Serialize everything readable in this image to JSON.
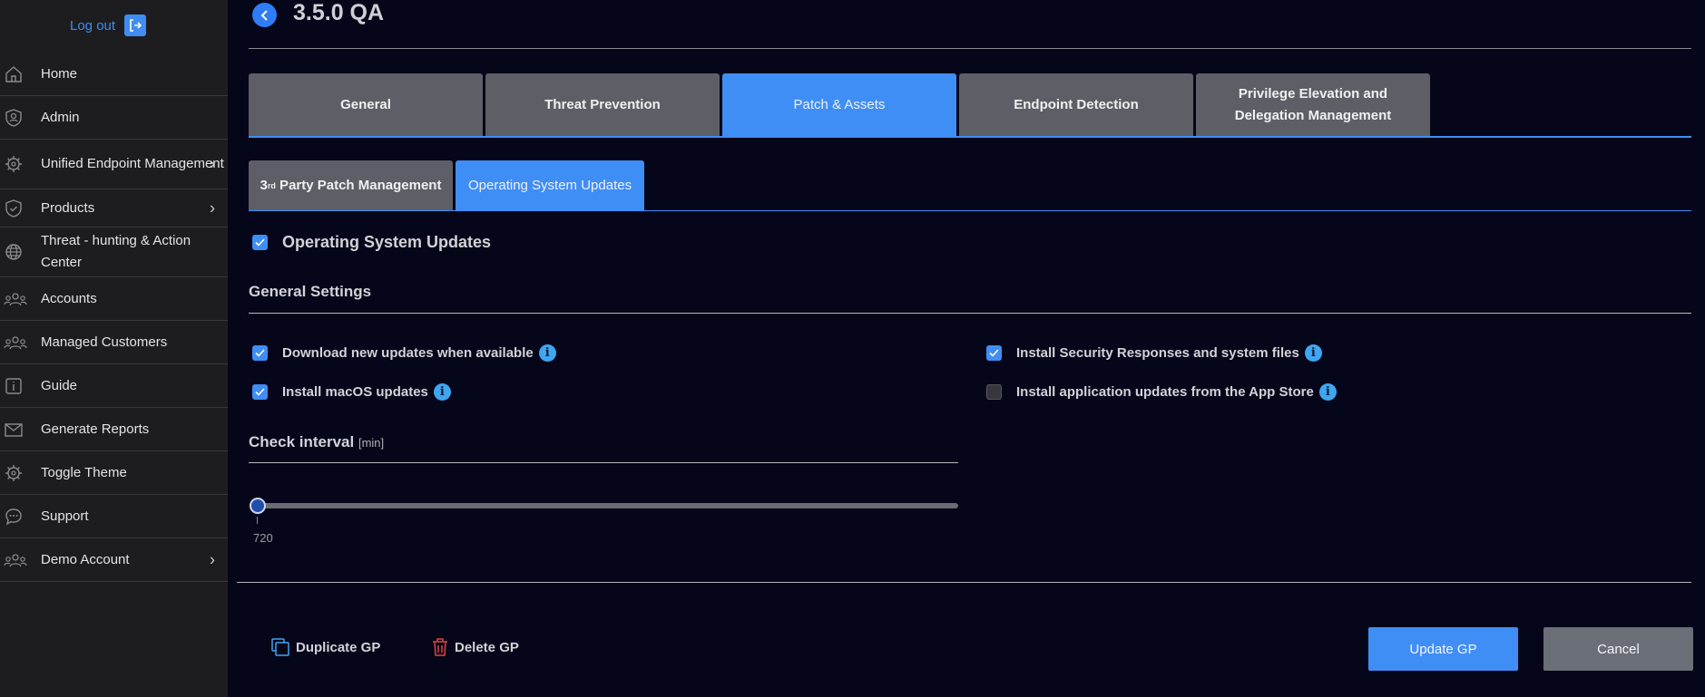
{
  "sidebar": {
    "logout_label": "Log out",
    "items": [
      {
        "label": "Home",
        "icon": "home-icon",
        "chevron": false
      },
      {
        "label": "Admin",
        "icon": "admin-shield-icon",
        "chevron": false
      },
      {
        "label": "Unified Endpoint Management",
        "icon": "gear-icon",
        "chevron": true
      },
      {
        "label": "Products",
        "icon": "shield-check-icon",
        "chevron": true
      },
      {
        "label": "Threat - hunting & Action Center",
        "icon": "globe-icon",
        "chevron": false
      },
      {
        "label": "Accounts",
        "icon": "users-icon",
        "chevron": false
      },
      {
        "label": "Managed Customers",
        "icon": "users-icon",
        "chevron": false
      },
      {
        "label": "Guide",
        "icon": "info-box-icon",
        "chevron": false
      },
      {
        "label": "Generate Reports",
        "icon": "mail-icon",
        "chevron": false
      },
      {
        "label": "Toggle Theme",
        "icon": "gear-icon",
        "chevron": false
      },
      {
        "label": "Support",
        "icon": "chat-icon",
        "chevron": false
      },
      {
        "label": "Demo Account",
        "icon": "users-icon",
        "chevron": true
      }
    ]
  },
  "header": {
    "title": "3.5.0 QA"
  },
  "tabs": [
    {
      "label": "General",
      "active": false
    },
    {
      "label": "Threat Prevention",
      "active": false
    },
    {
      "label": "Patch & Assets",
      "active": true
    },
    {
      "label": "Endpoint Detection",
      "active": false
    },
    {
      "label": "Privilege Elevation and Delegation Management",
      "active": false
    }
  ],
  "subtabs": {
    "third_party": {
      "prefix": "3",
      "sup": "rd",
      "suffix": " Party Patch Management"
    },
    "os_updates": "Operating System Updates"
  },
  "os_updates": {
    "label": "Operating System Updates",
    "checked": true
  },
  "general_settings": {
    "title": "General Settings",
    "options": {
      "download": {
        "label": "Download new updates when available",
        "checked": true
      },
      "macos": {
        "label": "Install macOS updates",
        "checked": true
      },
      "security": {
        "label": "Install Security Responses and system files",
        "checked": true
      },
      "appstore": {
        "label": "Install application updates from the App Store",
        "checked": false
      }
    }
  },
  "check_interval": {
    "title": "Check interval",
    "unit": "[min]",
    "value": "720"
  },
  "actions": {
    "duplicate": "Duplicate GP",
    "delete": "Delete GP",
    "update": "Update GP",
    "cancel": "Cancel"
  },
  "colors": {
    "accent": "#3f8ef5",
    "sidebar": "#1d1d1f",
    "background": "#06061a",
    "info": "#3fa6f0",
    "delete": "#e0463c"
  }
}
